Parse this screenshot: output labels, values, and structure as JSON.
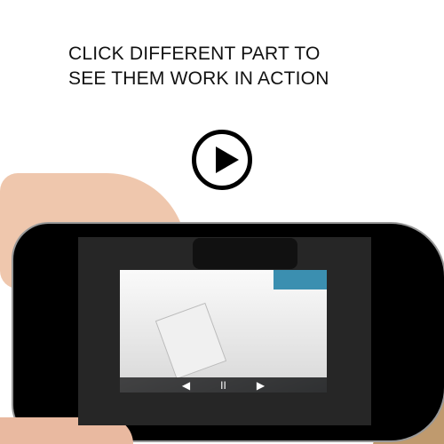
{
  "headline": {
    "line1": "CLICK DIFFERENT PART TO",
    "line2": "SEE THEM WORK IN ACTION"
  },
  "play_icon": "play-circle-icon",
  "video_controls": {
    "prev": "◀",
    "pause": "II",
    "next": "▶"
  }
}
